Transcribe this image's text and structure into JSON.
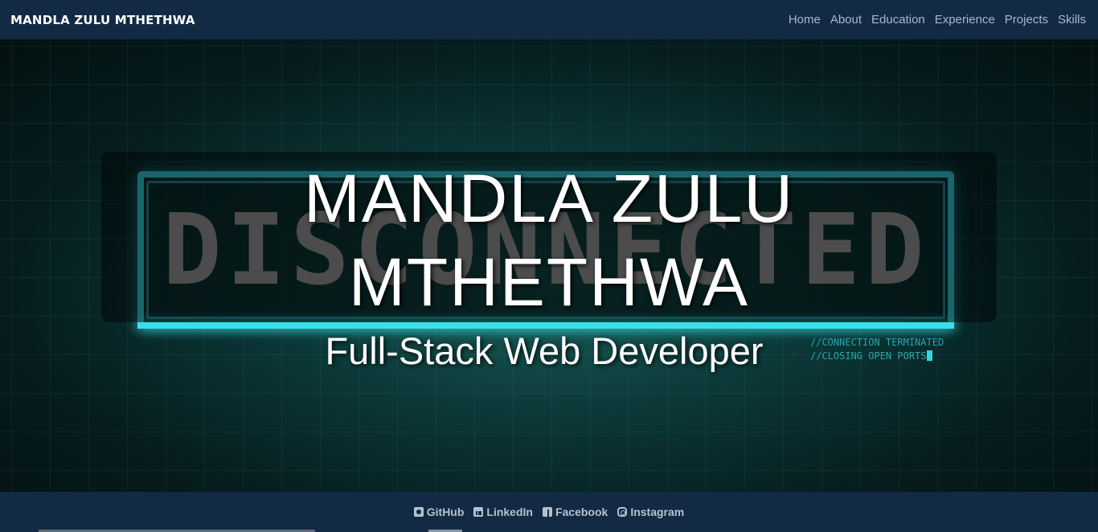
{
  "nav": {
    "brand": "MANDLA ZULU MTHETHWA",
    "links": [
      "Home",
      "About",
      "Education",
      "Experience",
      "Projects",
      "Skills"
    ]
  },
  "hero": {
    "background_text": "DISCONNECTED",
    "terminal_lines": [
      "//CONNECTION TERMINATED",
      "//CLOSING OPEN PORTS"
    ],
    "title_line1": "MANDLA ZULU",
    "title_line2": "MTHETHWA",
    "subtitle": "Full-Stack Web Developer"
  },
  "footer": {
    "links": [
      {
        "label": "GitHub",
        "icon": "github-icon"
      },
      {
        "label": "LinkedIn",
        "icon": "linkedin-icon"
      },
      {
        "label": "Facebook",
        "icon": "facebook-icon"
      },
      {
        "label": "Instagram",
        "icon": "instagram-icon"
      }
    ]
  },
  "colors": {
    "navbar": "#132a44",
    "accent_cyan": "#2fb9c4",
    "nav_text": "#aab8c8"
  }
}
